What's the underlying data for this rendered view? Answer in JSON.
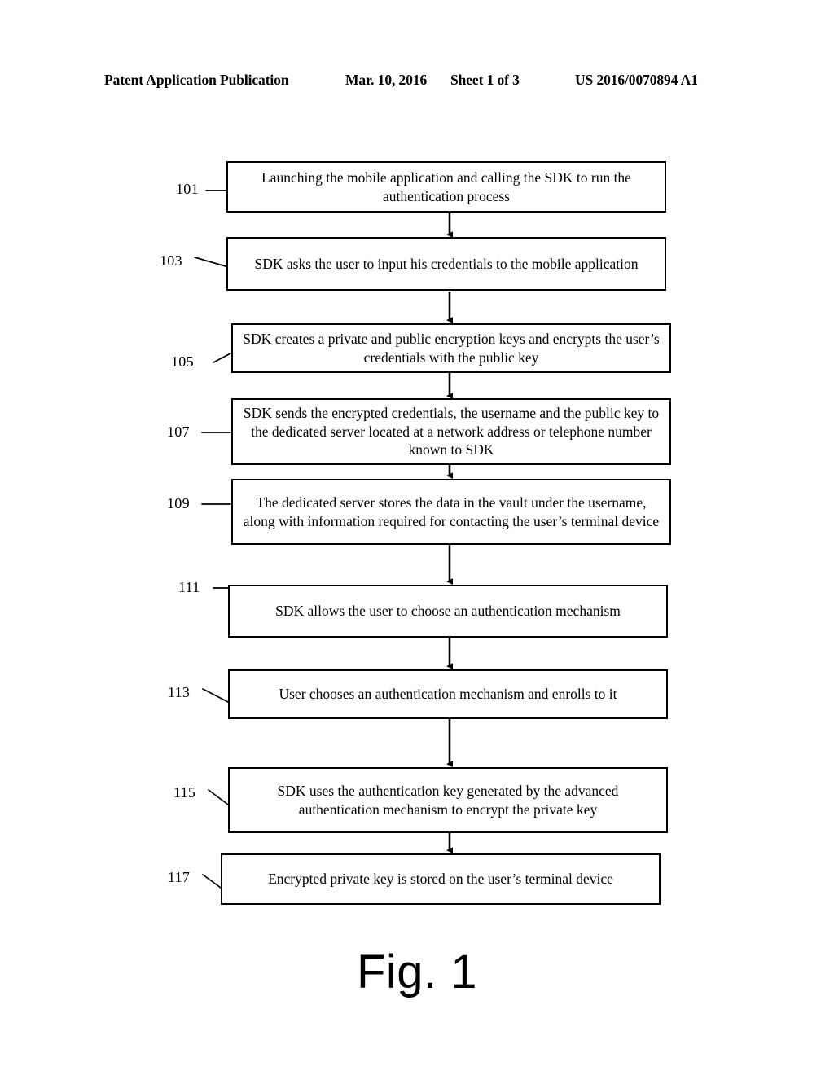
{
  "header": {
    "publication": "Patent Application Publication",
    "date": "Mar. 10, 2016",
    "sheet": "Sheet 1 of 3",
    "patent_number": "US 2016/0070894 A1"
  },
  "figure": {
    "caption": "Fig. 1"
  },
  "flowchart": {
    "steps": [
      {
        "ref": "101",
        "text": "Launching the mobile application and calling the SDK to run the authentication process"
      },
      {
        "ref": "103",
        "text": "SDK asks the user to input his credentials to the mobile application"
      },
      {
        "ref": "105",
        "text": "SDK creates a private and public encryption keys and encrypts the user’s credentials with the public key"
      },
      {
        "ref": "107",
        "text": "SDK sends the encrypted credentials, the username and the public key to the dedicated server located at a network address or telephone number known to SDK"
      },
      {
        "ref": "109",
        "text": "The dedicated server stores the data in the vault under the username, along with information required for contacting the user’s terminal device"
      },
      {
        "ref": "111",
        "text": "SDK allows the user to choose an authentication mechanism"
      },
      {
        "ref": "113",
        "text": "User chooses an authentication mechanism and enrolls to it"
      },
      {
        "ref": "115",
        "text": "SDK uses the authentication key generated by the advanced authentication mechanism to encrypt the private key"
      },
      {
        "ref": "117",
        "text": "Encrypted private key is stored on the user’s terminal device"
      }
    ]
  },
  "colors": {
    "ink": "#000000",
    "paper": "#ffffff"
  }
}
